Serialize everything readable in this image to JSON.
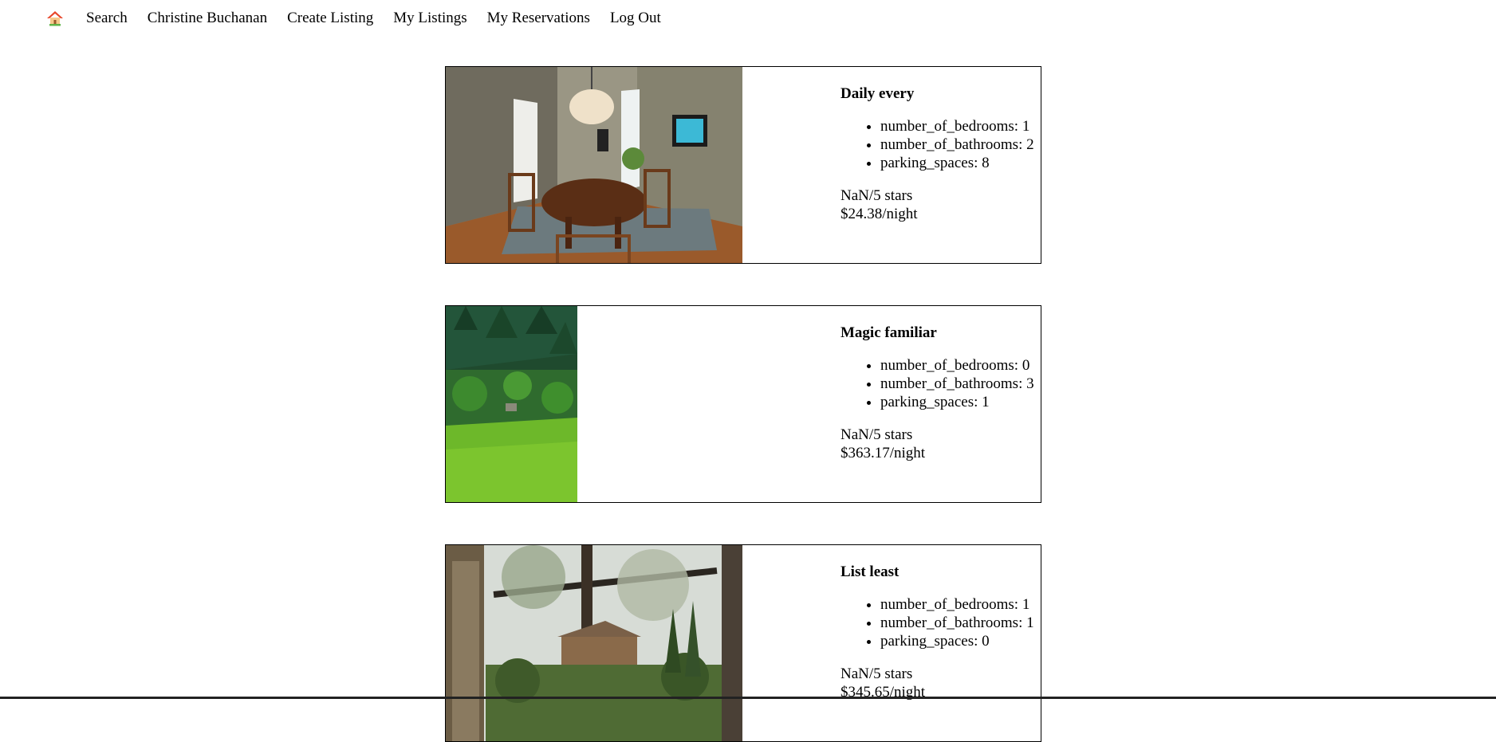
{
  "nav": {
    "home_icon": "home-icon",
    "items": [
      "Search",
      "Christine Buchanan",
      "Create Listing",
      "My Listings",
      "My Reservations",
      "Log Out"
    ]
  },
  "listings": [
    {
      "title": "Daily every",
      "image": "dining-room-photo",
      "details": [
        "number_of_bedrooms: 1",
        "number_of_bathrooms: 2",
        "parking_spaces: 8"
      ],
      "rating": "NaN/5 stars",
      "price": "$24.38/night"
    },
    {
      "title": "Magic familiar",
      "image": "forest-meadow-photo",
      "details": [
        "number_of_bedrooms: 0",
        "number_of_bathrooms: 3",
        "parking_spaces: 1"
      ],
      "rating": "NaN/5 stars",
      "price": "$363.17/night"
    },
    {
      "title": "List least",
      "image": "garden-house-photo",
      "details": [
        "number_of_bedrooms: 1",
        "number_of_bathrooms: 1",
        "parking_spaces: 0"
      ],
      "rating": "NaN/5 stars",
      "price": "$345.65/night"
    }
  ]
}
